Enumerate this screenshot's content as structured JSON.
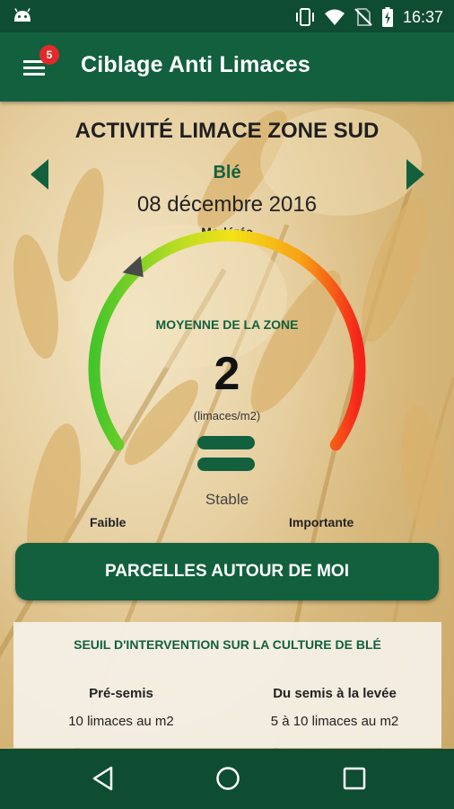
{
  "status_bar": {
    "time": "16:37",
    "icons": [
      "android-icon",
      "vibrate-icon",
      "wifi-icon",
      "no-sim-icon",
      "battery-charging-icon"
    ]
  },
  "app_bar": {
    "title": "Ciblage Anti Limaces",
    "menu_badge": "5"
  },
  "zone": {
    "title": "ACTIVITÉ LIMACE ZONE SUD",
    "crop": "Blé",
    "date": "08 décembre 2016"
  },
  "gauge": {
    "level_label": "Modérée",
    "low_label": "Faible",
    "high_label": "Importante",
    "subtitle": "MOYENNE DE LA ZONE",
    "value": "2",
    "unit": "(limaces/m2)",
    "trend": "Stable",
    "pointer_fraction": 0.33,
    "colors": {
      "low": "#43c52a",
      "mid": "#f3e117",
      "high": "#f5221a"
    }
  },
  "cta": {
    "label": "PARCELLES AUTOUR DE MOI"
  },
  "threshold": {
    "title": "SEUIL D'INTERVENTION SUR LA CULTURE DE BLÉ",
    "columns": [
      {
        "label": "Pré-semis",
        "value": "10 limaces au m2"
      },
      {
        "label": "Du semis à la levée",
        "value": "5 à 10 limaces au m2"
      }
    ]
  },
  "theme": {
    "primary": "#13603f",
    "dark": "#0f4d33"
  }
}
